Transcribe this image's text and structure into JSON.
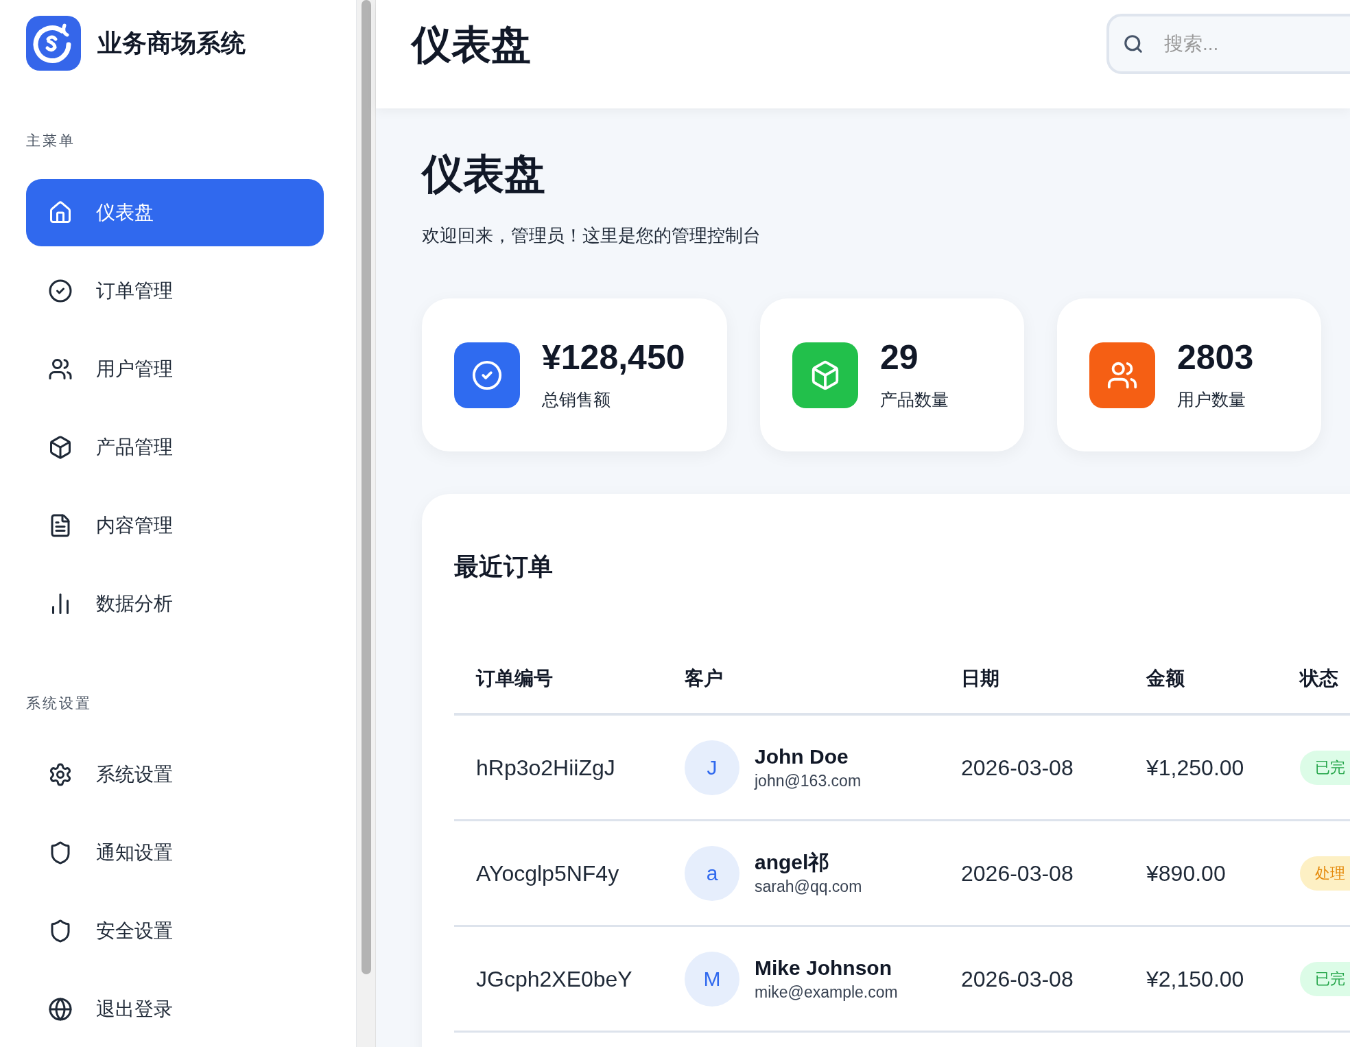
{
  "sidebar": {
    "brand": "业务商场系统",
    "sections": [
      {
        "title": "主菜单",
        "items": [
          {
            "label": "仪表盘",
            "kind": "home",
            "selected": true
          },
          {
            "label": "订单管理",
            "kind": "check",
            "selected": false
          },
          {
            "label": "用户管理",
            "kind": "users",
            "selected": false
          },
          {
            "label": "产品管理",
            "kind": "box",
            "selected": false
          },
          {
            "label": "内容管理",
            "kind": "file",
            "selected": false
          },
          {
            "label": "数据分析",
            "kind": "chart",
            "selected": false
          }
        ]
      },
      {
        "title": "系统设置",
        "items": [
          {
            "label": "系统设置",
            "kind": "gear",
            "selected": false
          },
          {
            "label": "通知设置",
            "kind": "shield",
            "selected": false
          },
          {
            "label": "安全设置",
            "kind": "shield",
            "selected": false
          },
          {
            "label": "退出登录",
            "kind": "globe",
            "selected": false
          }
        ]
      }
    ]
  },
  "header": {
    "title": "仪表盘",
    "search": {
      "placeholder": "搜索..."
    }
  },
  "page": {
    "title": "仪表盘",
    "subtitle": "欢迎回来，管理员！这里是您的管理控制台"
  },
  "stats": [
    {
      "value": "¥128,450",
      "label": "总销售额",
      "kind": "check",
      "color": "#2f6bf0"
    },
    {
      "value": "29",
      "label": "产品数量",
      "kind": "box",
      "color": "#22c04b"
    },
    {
      "value": "2803",
      "label": "用户数量",
      "kind": "users",
      "color": "#f55f14"
    }
  ],
  "orders": {
    "title": "最近订单",
    "columns": [
      "订单编号",
      "客户",
      "日期",
      "金额",
      "状态"
    ],
    "rows": [
      {
        "id": "hRp3o2HiiZgJ",
        "avatar": "J",
        "name": "John Doe",
        "email": "john@163.com",
        "date": "2026-03-08",
        "amount": "¥1,250.00",
        "status": "已完",
        "kind": "done"
      },
      {
        "id": "AYocglp5NF4y",
        "avatar": "a",
        "name": "angel祁",
        "email": "sarah@qq.com",
        "date": "2026-03-08",
        "amount": "¥890.00",
        "status": "处理",
        "kind": "processing"
      },
      {
        "id": "JGcph2XE0beY",
        "avatar": "M",
        "name": "Mike Johnson",
        "email": "mike@example.com",
        "date": "2026-03-08",
        "amount": "¥2,150.00",
        "status": "已完",
        "kind": "done"
      }
    ]
  }
}
